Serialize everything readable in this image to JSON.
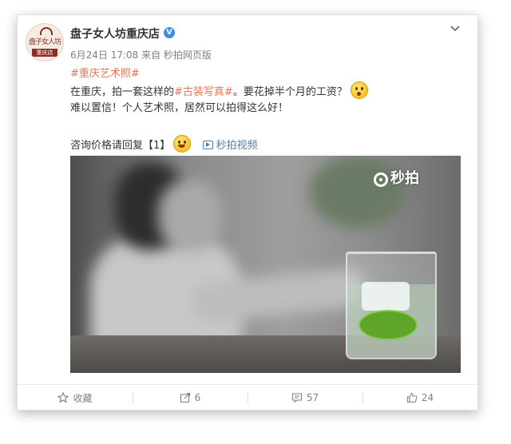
{
  "post": {
    "author": "盘子女人坊重庆店",
    "avatar": {
      "brand": "盘子女人坊",
      "tag": "重庆店"
    },
    "meta": "6月24日 17:08 来自 秒拍网页版",
    "hashtag_line": "#重庆艺术照#",
    "line2_start": "在重庆，拍一套这样的",
    "line2_tag": "#古装写真#",
    "line2_end": "。要花掉半个月的工资？",
    "line3": "难以置信！个人艺术照，居然可以拍得这么好！",
    "line4": "咨询价格请回复【1】",
    "video_link": "秒拍视频",
    "video_watermark": "秒拍"
  },
  "actions": {
    "favorite_label": "收藏",
    "repost_count": "6",
    "comment_count": "57",
    "like_count": "24"
  },
  "icons": [
    "verified-icon",
    "chevron-down-icon",
    "surprised-emoji",
    "happy-emoji",
    "video-icon",
    "star-icon",
    "repost-icon",
    "comment-icon",
    "like-icon"
  ],
  "colors": {
    "link": "#eb7350",
    "blue_link": "#507daf",
    "verified": "#3f8be6",
    "meta": "#808080"
  }
}
